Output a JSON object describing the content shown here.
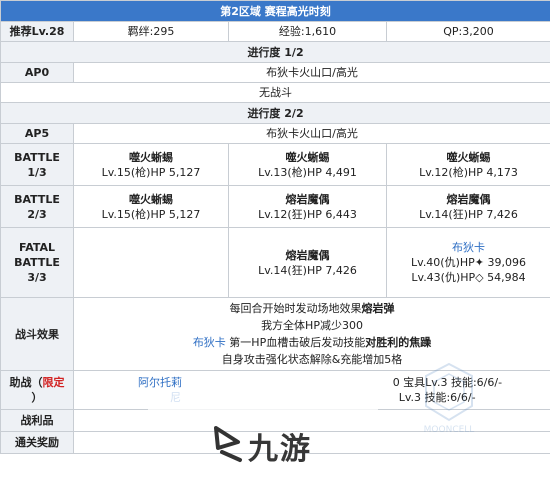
{
  "title": "第2区域 赛程高光时刻",
  "info": {
    "label": "推荐Lv.28",
    "bond": "羁绊:295",
    "exp": "经验:1,610",
    "qp": "QP:3,200"
  },
  "progress1": {
    "header": "进行度 1/2",
    "ap_label": "AP0",
    "location": "布狄卡火山口/高光",
    "no_battle": "无战斗"
  },
  "progress2": {
    "header": "进行度 2/2",
    "ap_label": "AP5",
    "location": "布狄卡火山口/高光",
    "battles": [
      {
        "label_line1": "BATTLE",
        "label_line2": "1/3",
        "enemies": [
          {
            "name": "噬火蜥蜴",
            "stats": "Lv.15(枪)HP 5,127"
          },
          {
            "name": "噬火蜥蜴",
            "stats": "Lv.13(枪)HP 4,491"
          },
          {
            "name": "噬火蜥蜴",
            "stats": "Lv.12(枪)HP 4,173"
          }
        ]
      },
      {
        "label_line1": "BATTLE",
        "label_line2": "2/3",
        "enemies": [
          {
            "name": "噬火蜥蜴",
            "stats": "Lv.15(枪)HP 5,127"
          },
          {
            "name": "熔岩魔偶",
            "stats": "Lv.12(狂)HP 6,443"
          },
          {
            "name": "熔岩魔偶",
            "stats": "Lv.14(狂)HP 7,426"
          }
        ]
      }
    ],
    "fatal": {
      "label_line1": "FATAL",
      "label_line2": "BATTLE",
      "label_line3": "3/3",
      "enemy_mid": {
        "name": "熔岩魔偶",
        "stats": "Lv.14(狂)HP 7,426"
      },
      "enemy_right": {
        "name": "布狄卡",
        "stats1": "Lv.40(仇)HP✦ 39,096",
        "stats2": "Lv.43(仇)HP◇ 54,984"
      }
    }
  },
  "effects": {
    "label": "战斗效果",
    "line1_prefix": "每回合开始时发动场地效果",
    "line1_bold": "熔岩弹",
    "line2": "我方全体HP减少300",
    "line3_name": "布狄卡",
    "line3_mid": " 第一HP血槽击破后发动技能",
    "line3_bold": "对胜利的焦躁",
    "line4": "自身攻击强化状态解除&充能增加5格"
  },
  "support": {
    "label_prefix": "助战（",
    "label_red": "限定",
    "label_suffix": "）",
    "left_line1": "阿尔托莉",
    "left_line2": "尼",
    "right_line1": "0 宝具Lv.3 技能:6/6/-",
    "right_line2": "Lv.3 技能:6/6/-"
  },
  "loot": {
    "label": "战利品"
  },
  "clear_reward": {
    "label": "通关奖励"
  },
  "watermark": {
    "text": "九游",
    "brand": "MOONCELL"
  },
  "colors": {
    "title_bg": "#3a78c9",
    "header_bg": "#eef1f5",
    "accent_blue": "#2f6fc4",
    "limited_red": "#d22222"
  }
}
